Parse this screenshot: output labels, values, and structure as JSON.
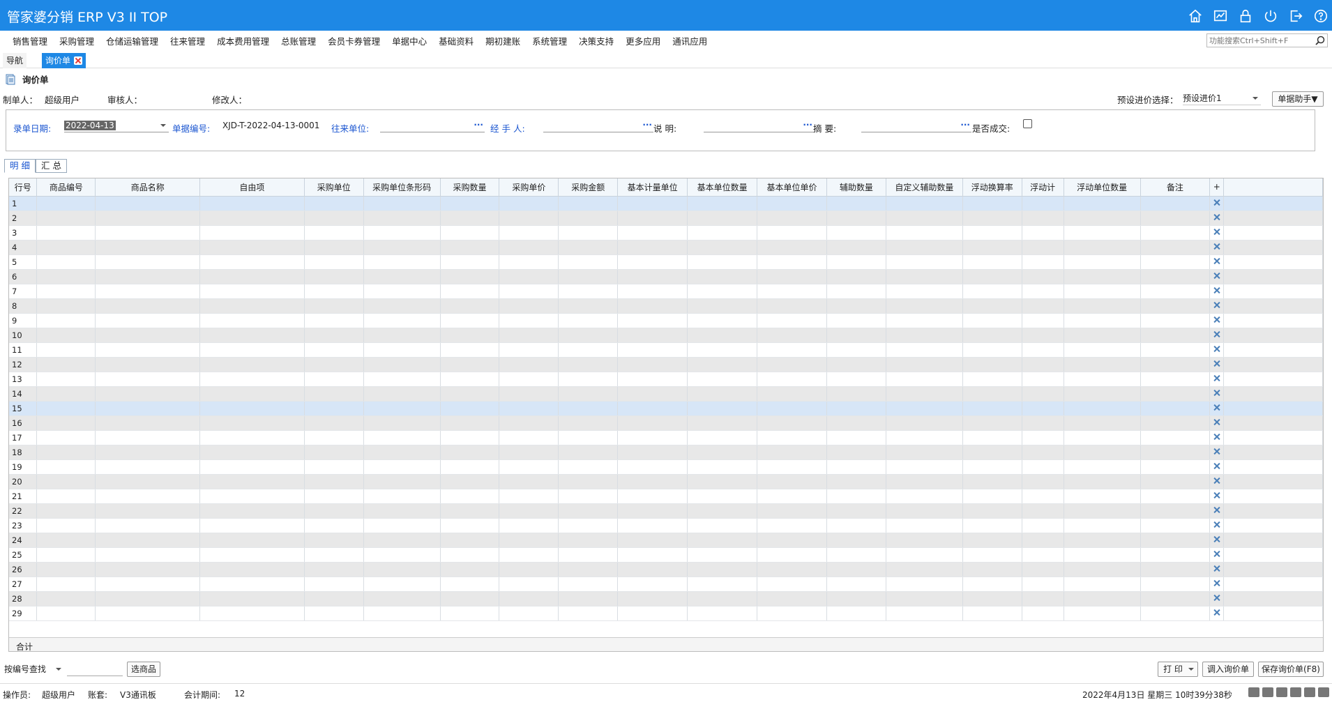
{
  "app": {
    "title": "管家婆分销 ERP V3 II TOP"
  },
  "title_icons": [
    "home-icon",
    "chart-icon",
    "lock-icon",
    "power-icon",
    "exit-icon",
    "help-icon"
  ],
  "menu": [
    "销售管理",
    "采购管理",
    "仓储运输管理",
    "往来管理",
    "成本费用管理",
    "总账管理",
    "会员卡券管理",
    "单据中心",
    "基础资料",
    "期初建账",
    "系统管理",
    "决策支持",
    "更多应用",
    "通讯应用"
  ],
  "func_search": {
    "placeholder": "功能搜索Ctrl+Shift+F"
  },
  "tabs": {
    "nav": "导航",
    "quote": "询价单"
  },
  "doc": {
    "title": "询价单"
  },
  "info": {
    "maker_label": "制单人：",
    "maker_value": "超级用户",
    "auditor_label": "审核人：",
    "modifier_label": "修改人：",
    "preset_label": "预设进价选择：",
    "preset_value": "预设进价1",
    "helper_label": "单据助手▼"
  },
  "form": {
    "date_label": "录单日期:",
    "date_value": "2022-04-13",
    "docno_label": "单据编号:",
    "docno_value": "XJD-T-2022-04-13-0001",
    "partner_label": "往来单位:",
    "handler_label": "经  手  人:",
    "desc_label": "说    明:",
    "summary_label": "摘    要:",
    "deal_label": "是否成交:",
    "dots": "···"
  },
  "subtabs": {
    "detail": "明 细",
    "summary": "汇 总"
  },
  "grid": {
    "columns": [
      "行号",
      "商品编号",
      "商品名称",
      "自由项",
      "采购单位",
      "采购单位条形码",
      "采购数量",
      "采购单价",
      "采购金额",
      "基本计量单位",
      "基本单位数量",
      "基本单位单价",
      "辅助数量",
      "自定义辅助数量",
      "浮动换算率",
      "浮动计",
      "浮动单位数量",
      "备注",
      "+"
    ],
    "rows": [
      "1",
      "2",
      "3",
      "4",
      "5",
      "6",
      "7",
      "8",
      "9",
      "10",
      "11",
      "12",
      "13",
      "14",
      "15",
      "16",
      "17",
      "18",
      "19",
      "20",
      "21",
      "22",
      "23",
      "24",
      "25",
      "26",
      "27",
      "28",
      "29"
    ],
    "total_label": "合计"
  },
  "bottom": {
    "search_mode": "按编号查找",
    "select_goods": "选商品",
    "print": "打 印",
    "import": "调入询价单",
    "save": "保存询价单(F8)"
  },
  "status": {
    "operator_label": "操作员:",
    "operator_value": "超级用户",
    "account_label": "账套:",
    "account_value": "V3通讯板",
    "period_label": "会计期间:",
    "period_value": "12",
    "datetime": "2022年4月13日  星期三  10时39分38秒"
  }
}
